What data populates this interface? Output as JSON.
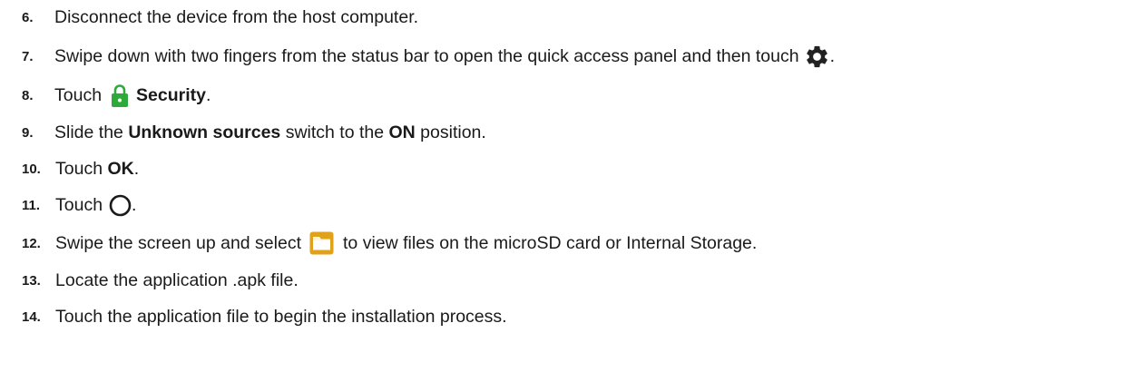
{
  "steps": [
    {
      "number": "6.",
      "text": "Disconnect the device from the host computer."
    },
    {
      "number": "7.",
      "text": "Swipe down with two fingers from the status bar to open the quick access panel and then touch",
      "icon": "gear-icon",
      "after": "."
    },
    {
      "number": "8.",
      "before": "Touch",
      "icon": "lock-icon",
      "icon_color": "#2eaa3a",
      "bold": "Security",
      "after": "."
    },
    {
      "number": "9.",
      "before": "Slide the",
      "bold": "Unknown sources",
      "middle": "switch to the",
      "bold2": "ON",
      "after": "position."
    },
    {
      "number": "10.",
      "before": "Touch",
      "bold": "OK",
      "after": "."
    },
    {
      "number": "11.",
      "before": "Touch",
      "icon": "home-circle-icon",
      "after": "."
    },
    {
      "number": "12.",
      "before": "Swipe the screen up and select",
      "icon": "file-browser-icon",
      "icon_color": "#e0a21b",
      "after": "to view files on the microSD card or Internal Storage."
    },
    {
      "number": "13.",
      "text": "Locate the application .apk file."
    },
    {
      "number": "14.",
      "text": "Touch the application file to begin the installation process."
    }
  ]
}
